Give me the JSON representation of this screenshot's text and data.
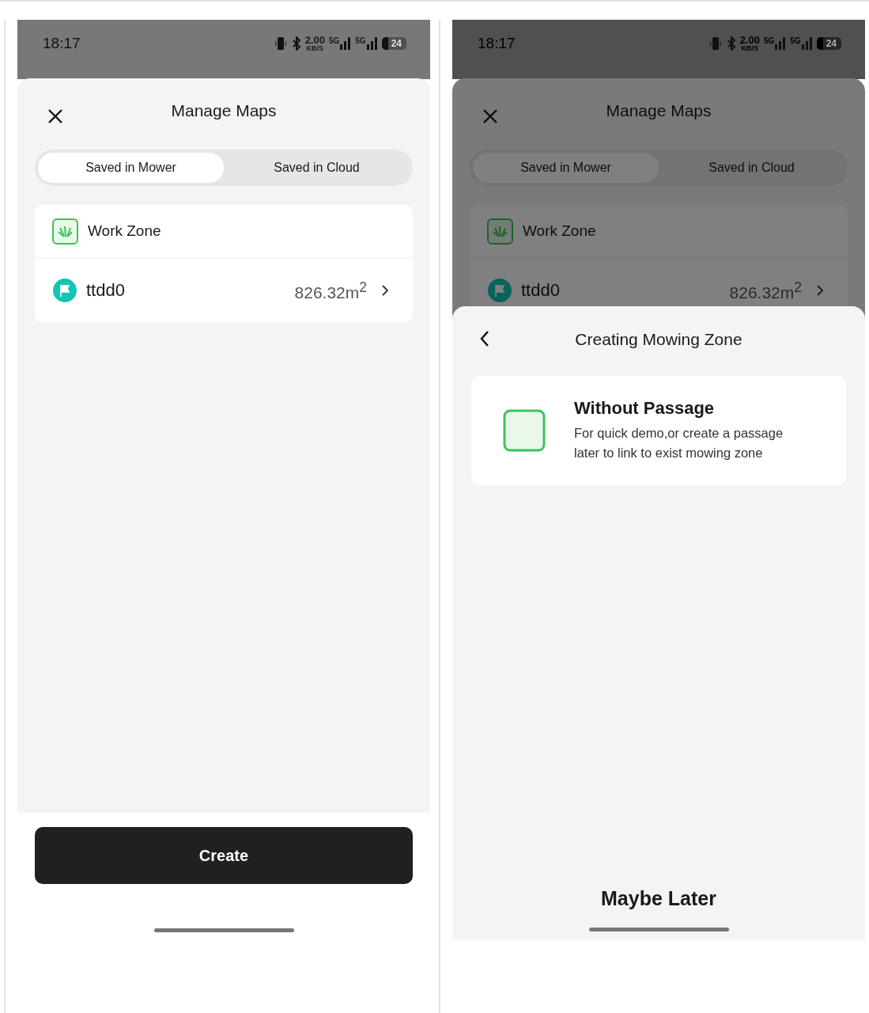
{
  "screens": [
    {
      "dimmed": false,
      "status_bar": {
        "time": "18:17",
        "speed": "2.00",
        "speed_unit": "KB/S",
        "network_1": "5G",
        "network_2": "5G",
        "battery": "24"
      },
      "title": "Manage Maps",
      "tabs": [
        {
          "label": "Saved in Mower",
          "selected": true
        },
        {
          "label": "Saved in Cloud",
          "selected": false
        }
      ],
      "zone_header": "Work Zone",
      "maps": [
        {
          "name": "ttdd0",
          "area": "826.32m$^{2}$"
        }
      ],
      "create_button": "Create"
    },
    {
      "dimmed": true,
      "status_bar": {
        "time": "18:17",
        "speed": "2.00",
        "speed_unit": "KB/S",
        "network_1": "5G",
        "network_2": "5G",
        "battery": "24"
      },
      "title": "Manage Maps",
      "tabs": [
        {
          "label": "Saved in Mower",
          "selected": true
        },
        {
          "label": "Saved in Cloud",
          "selected": false
        }
      ],
      "zone_header": "Work Zone",
      "maps": [
        {
          "name": "ttdd0",
          "area": "826.32m$^{2}$"
        }
      ],
      "sheet": {
        "title": "Creating Mowing Zone",
        "options": [
          {
            "title": "Without Passage",
            "description": "For quick demo,or create a passage later to link to exist mowing zone"
          }
        ],
        "dismiss": "Maybe Later"
      }
    }
  ]
}
